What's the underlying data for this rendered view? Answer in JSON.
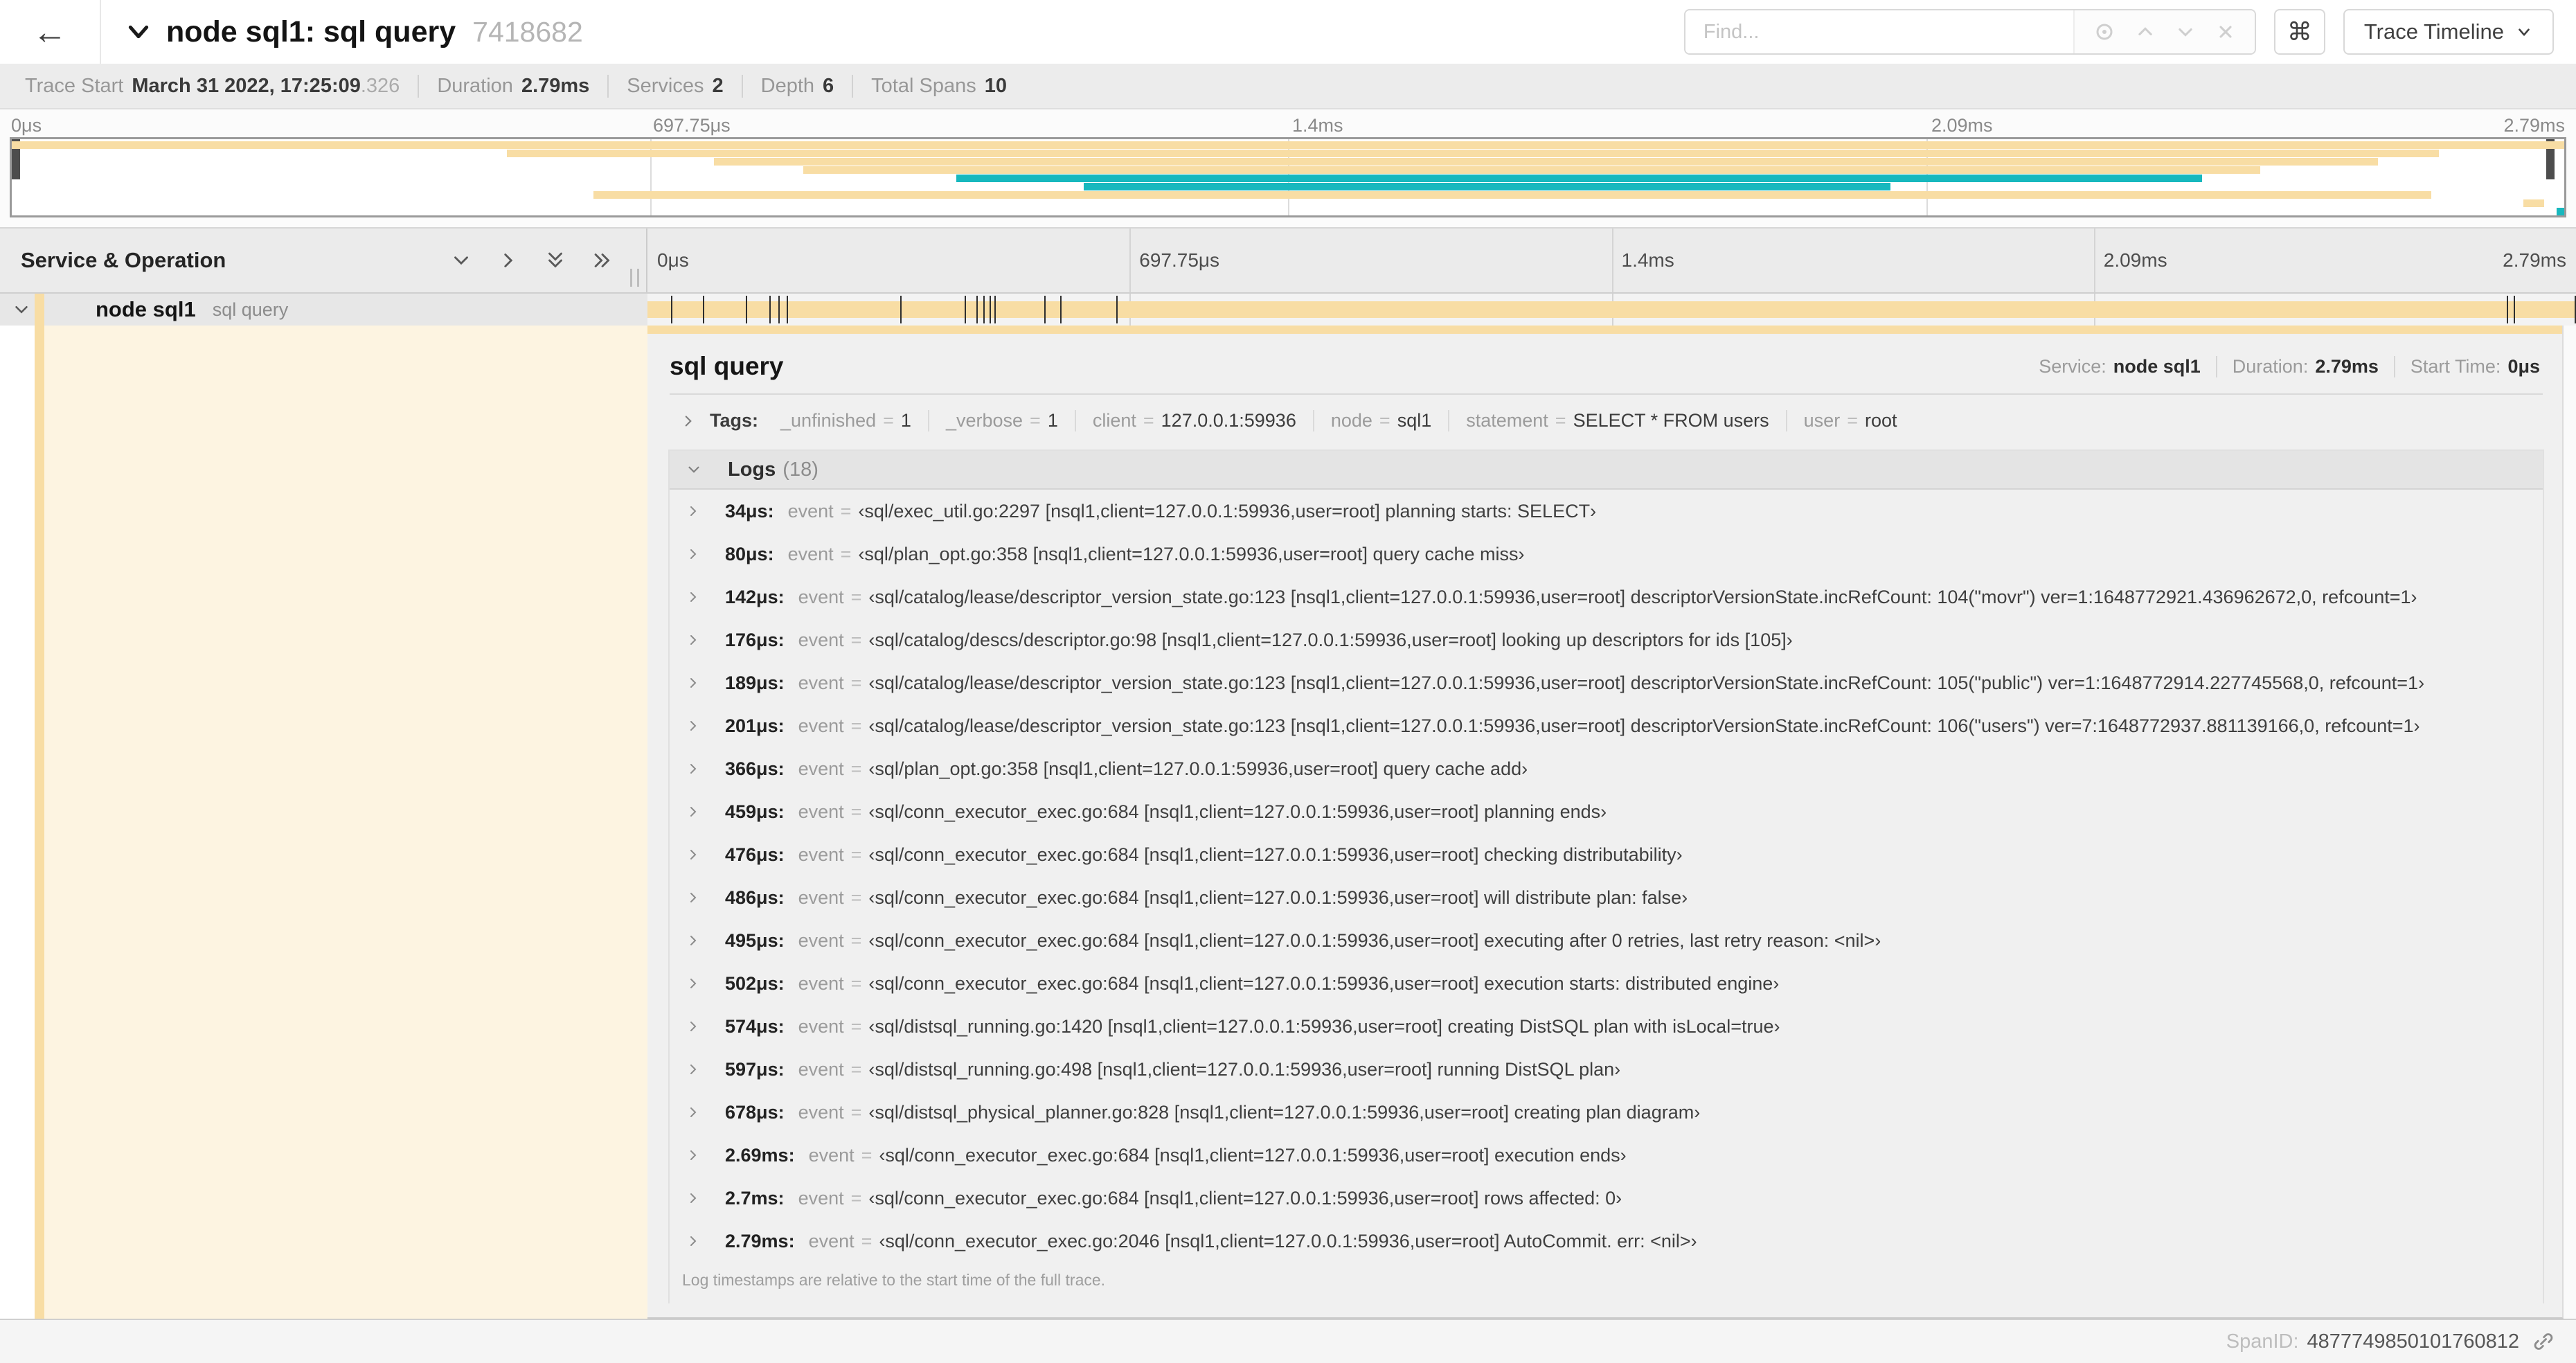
{
  "colors": {
    "span_tan": "#F8DDA4",
    "span_teal": "#17B8BE",
    "teal_dark": "#0E8C92"
  },
  "misc": {
    "equals": "="
  },
  "header": {
    "back_icon": "←",
    "title": "node sql1: sql query",
    "trace_id": "7418682",
    "find_placeholder": "Find...",
    "shortcut_button": "⌘",
    "view_label": "Trace Timeline"
  },
  "trace_info": {
    "items": [
      {
        "label": "Trace Start",
        "value": "March 31 2022, 17:25:09",
        "suffix": ".326"
      },
      {
        "label": "Duration",
        "value": "2.79ms"
      },
      {
        "label": "Services",
        "value": "2"
      },
      {
        "label": "Depth",
        "value": "6"
      },
      {
        "label": "Total Spans",
        "value": "10"
      }
    ]
  },
  "chart_data": {
    "type": "area",
    "title": "trace span minimap",
    "x_ticks": [
      "0μs",
      "697.75μs",
      "1.4ms",
      "2.09ms",
      "2.79ms"
    ],
    "xlim_ms": [
      0,
      2.79
    ],
    "spans_pct": [
      {
        "row": 0,
        "start": 0,
        "end": 100,
        "color": "tan"
      },
      {
        "row": 1,
        "start": 19.4,
        "end": 95.1,
        "color": "tan"
      },
      {
        "row": 2,
        "start": 27.5,
        "end": 92.7,
        "color": "tan"
      },
      {
        "row": 3,
        "start": 31,
        "end": 88.1,
        "color": "tan"
      },
      {
        "row": 4,
        "start": 37,
        "end": 85.8,
        "color": "teal"
      },
      {
        "row": 5,
        "start": 42,
        "end": 73.6,
        "color": "teal"
      },
      {
        "row": 6,
        "start": 22.8,
        "end": 94.8,
        "color": "tan"
      },
      {
        "row": 7,
        "start": 98.4,
        "end": 99.2,
        "color": "tan"
      },
      {
        "row": 8,
        "start": 99.7,
        "end": 100,
        "color": "teal"
      }
    ]
  },
  "minimap": {
    "ticks": [
      "0μs",
      "697.75μs",
      "1.4ms",
      "2.09ms",
      "2.79ms"
    ]
  },
  "timeline": {
    "left_header": "Service & Operation",
    "ticks": [
      "0μs",
      "697.75μs",
      "1.4ms",
      "2.09ms",
      "2.79ms"
    ],
    "row": {
      "service": "node sql1",
      "operation": "sql query"
    },
    "log_marker_positions_pct": [
      1.22,
      2.87,
      5.09,
      6.31,
      6.77,
      7.2,
      13.12,
      16.45,
      17.06,
      17.42,
      17.74,
      17.99,
      20.57,
      21.4,
      24.3,
      96.42,
      96.77,
      99.93
    ]
  },
  "detail": {
    "title": "sql query",
    "meta": [
      {
        "label": "Service:",
        "value": "node sql1"
      },
      {
        "label": "Duration:",
        "value": "2.79ms"
      },
      {
        "label": "Start Time:",
        "value": "0μs"
      }
    ],
    "tags_label": "Tags:",
    "tags": [
      {
        "key": "_unfinished",
        "value": "1"
      },
      {
        "key": "_verbose",
        "value": "1"
      },
      {
        "key": "client",
        "value": "127.0.0.1:59936"
      },
      {
        "key": "node",
        "value": "sql1"
      },
      {
        "key": "statement",
        "value": "SELECT * FROM users"
      },
      {
        "key": "user",
        "value": "root"
      }
    ],
    "logs_label": "Logs",
    "logs_count": "(18)",
    "logs": [
      {
        "time": "34μs:",
        "key": "event",
        "value": "‹sql/exec_util.go:2297 [nsql1,client=127.0.0.1:59936,user=root] planning starts: SELECT›"
      },
      {
        "time": "80μs:",
        "key": "event",
        "value": "‹sql/plan_opt.go:358 [nsql1,client=127.0.0.1:59936,user=root] query cache miss›"
      },
      {
        "time": "142μs:",
        "key": "event",
        "value": "‹sql/catalog/lease/descriptor_version_state.go:123 [nsql1,client=127.0.0.1:59936,user=root] descriptorVersionState.incRefCount: 104(\"movr\") ver=1:1648772921.436962672,0, refcount=1›"
      },
      {
        "time": "176μs:",
        "key": "event",
        "value": "‹sql/catalog/descs/descriptor.go:98 [nsql1,client=127.0.0.1:59936,user=root] looking up descriptors for ids [105]›"
      },
      {
        "time": "189μs:",
        "key": "event",
        "value": "‹sql/catalog/lease/descriptor_version_state.go:123 [nsql1,client=127.0.0.1:59936,user=root] descriptorVersionState.incRefCount: 105(\"public\") ver=1:1648772914.227745568,0, refcount=1›"
      },
      {
        "time": "201μs:",
        "key": "event",
        "value": "‹sql/catalog/lease/descriptor_version_state.go:123 [nsql1,client=127.0.0.1:59936,user=root] descriptorVersionState.incRefCount: 106(\"users\") ver=7:1648772937.881139166,0, refcount=1›"
      },
      {
        "time": "366μs:",
        "key": "event",
        "value": "‹sql/plan_opt.go:358 [nsql1,client=127.0.0.1:59936,user=root] query cache add›"
      },
      {
        "time": "459μs:",
        "key": "event",
        "value": "‹sql/conn_executor_exec.go:684 [nsql1,client=127.0.0.1:59936,user=root] planning ends›"
      },
      {
        "time": "476μs:",
        "key": "event",
        "value": "‹sql/conn_executor_exec.go:684 [nsql1,client=127.0.0.1:59936,user=root] checking distributability›"
      },
      {
        "time": "486μs:",
        "key": "event",
        "value": "‹sql/conn_executor_exec.go:684 [nsql1,client=127.0.0.1:59936,user=root] will distribute plan: false›"
      },
      {
        "time": "495μs:",
        "key": "event",
        "value": "‹sql/conn_executor_exec.go:684 [nsql1,client=127.0.0.1:59936,user=root] executing after 0 retries, last retry reason: <nil>›"
      },
      {
        "time": "502μs:",
        "key": "event",
        "value": "‹sql/conn_executor_exec.go:684 [nsql1,client=127.0.0.1:59936,user=root] execution starts: distributed engine›"
      },
      {
        "time": "574μs:",
        "key": "event",
        "value": "‹sql/distsql_running.go:1420 [nsql1,client=127.0.0.1:59936,user=root] creating DistSQL plan with isLocal=true›"
      },
      {
        "time": "597μs:",
        "key": "event",
        "value": "‹sql/distsql_running.go:498 [nsql1,client=127.0.0.1:59936,user=root] running DistSQL plan›"
      },
      {
        "time": "678μs:",
        "key": "event",
        "value": "‹sql/distsql_physical_planner.go:828 [nsql1,client=127.0.0.1:59936,user=root] creating plan diagram›"
      },
      {
        "time": "2.69ms:",
        "key": "event",
        "value": "‹sql/conn_executor_exec.go:684 [nsql1,client=127.0.0.1:59936,user=root] execution ends›"
      },
      {
        "time": "2.7ms:",
        "key": "event",
        "value": "‹sql/conn_executor_exec.go:684 [nsql1,client=127.0.0.1:59936,user=root] rows affected: 0›"
      },
      {
        "time": "2.79ms:",
        "key": "event",
        "value": "‹sql/conn_executor_exec.go:2046 [nsql1,client=127.0.0.1:59936,user=root] AutoCommit. err: <nil>›"
      }
    ],
    "logs_note": "Log timestamps are relative to the start time of the full trace.",
    "span_id_label": "SpanID:",
    "span_id": "4877749850101760812"
  }
}
